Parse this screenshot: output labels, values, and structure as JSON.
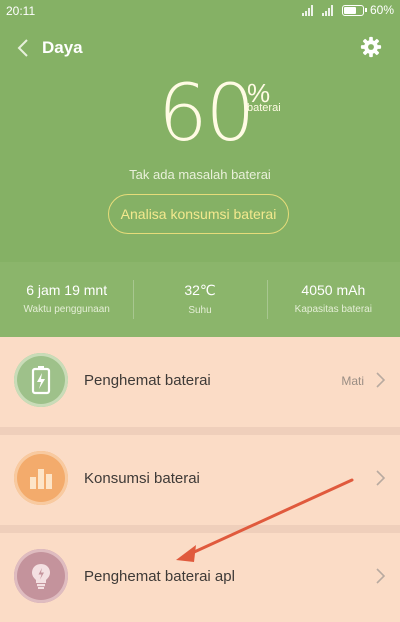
{
  "status_bar": {
    "time": "20:11",
    "battery_percent": "60%"
  },
  "header": {
    "title": "Daya",
    "back_icon": "chevron-left-icon",
    "settings_icon": "gear-icon"
  },
  "battery": {
    "percent": "60",
    "percent_sign": "%",
    "label": "baterai",
    "status_message": "Tak ada masalah baterai",
    "analyze_button": "Analisa konsumsi baterai"
  },
  "stats": [
    {
      "value": "6 jam 19 mnt",
      "label": "Waktu penggunaan"
    },
    {
      "value": "32℃",
      "label": "Suhu"
    },
    {
      "value": "4050 mAh",
      "label": "Kapasitas baterai"
    }
  ],
  "items": [
    {
      "label": "Penghemat baterai",
      "value": "Mati",
      "icon": "battery-bolt-icon",
      "color": "#8db479"
    },
    {
      "label": "Konsumsi baterai",
      "value": "",
      "icon": "bar-chart-icon",
      "color": "#f2a76a"
    },
    {
      "label": "Penghemat baterai apl",
      "value": "",
      "icon": "lightbulb-icon",
      "color": "#c2909a"
    }
  ],
  "colors": {
    "top_green": "#85b165",
    "list_bg": "#fbdcc6",
    "arrow": "#e05a3d"
  }
}
